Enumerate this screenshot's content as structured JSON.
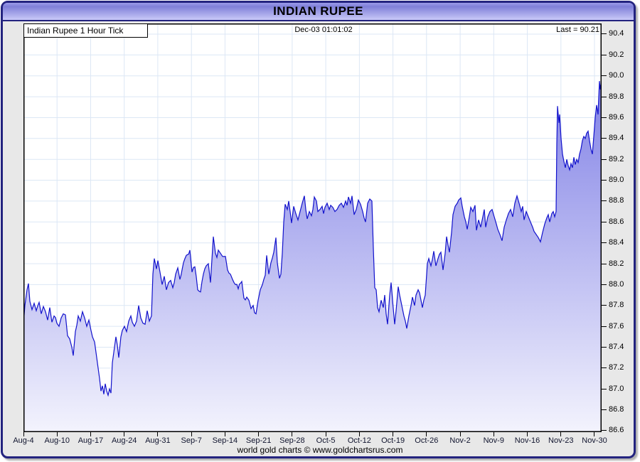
{
  "window": {
    "title": "INDIAN RUPEE"
  },
  "header": {
    "series_label": "Indian Rupee 1 Hour Tick",
    "timestamp": "Dec-03 01:01:02",
    "last_label": "Last = 90.21"
  },
  "footer": {
    "credit": "world gold charts © www.goldchartsrus.com"
  },
  "chart_data": {
    "type": "area",
    "title": "Indian Rupee 1 Hour Tick",
    "timestamp": "Dec-03 01:01:02",
    "last": 90.21,
    "ylabel": "",
    "xlabel": "",
    "ylim": [
      86.6,
      90.4
    ],
    "ytick_step": 0.2,
    "grid": true,
    "legend_position": "none",
    "y_ticks": [
      "90.4",
      "90.2",
      "90.0",
      "89.8",
      "89.6",
      "89.4",
      "89.2",
      "89.0",
      "88.8",
      "88.6",
      "88.4",
      "88.2",
      "88.0",
      "87.8",
      "87.6",
      "87.4",
      "87.2",
      "87.0",
      "86.8",
      "86.6"
    ],
    "x_ticks": [
      "Aug-4",
      "Aug-10",
      "Aug-17",
      "Aug-24",
      "Aug-31",
      "Sep-7",
      "Sep-14",
      "Sep-21",
      "Sep-28",
      "Oct-5",
      "Oct-12",
      "Oct-19",
      "Oct-26",
      "Nov-2",
      "Nov-9",
      "Nov-16",
      "Nov-23",
      "Nov-30"
    ],
    "colors": {
      "line": "#1212cc",
      "fill_top": "#6f6fe2",
      "fill_bottom": "#f3f3fd",
      "grid": "#dce7f5",
      "plot_border": "#000000",
      "titlebar_top": "#7f7fd8",
      "titlebar_bottom": "#c9c9f8",
      "frame": "#23237f",
      "panel_bg": "#e8e8e8"
    },
    "series": [
      {
        "name": "Indian Rupee",
        "points": [
          [
            33,
            87.62
          ],
          [
            35,
            87.8
          ],
          [
            38,
            87.95
          ],
          [
            40,
            88.01
          ],
          [
            42,
            87.84
          ],
          [
            45,
            87.76
          ],
          [
            48,
            87.82
          ],
          [
            51,
            87.75
          ],
          [
            55,
            87.83
          ],
          [
            58,
            87.72
          ],
          [
            61,
            87.79
          ],
          [
            64,
            87.74
          ],
          [
            67,
            87.66
          ],
          [
            70,
            87.78
          ],
          [
            73,
            87.64
          ],
          [
            76,
            87.7
          ],
          [
            80,
            87.63
          ],
          [
            83,
            87.6
          ],
          [
            86,
            87.68
          ],
          [
            89,
            87.72
          ],
          [
            92,
            87.71
          ],
          [
            95,
            87.51
          ],
          [
            98,
            87.48
          ],
          [
            101,
            87.4
          ],
          [
            103,
            87.32
          ],
          [
            106,
            87.55
          ],
          [
            110,
            87.7
          ],
          [
            113,
            87.65
          ],
          [
            116,
            87.74
          ],
          [
            119,
            87.68
          ],
          [
            122,
            87.6
          ],
          [
            125,
            87.66
          ],
          [
            128,
            87.56
          ],
          [
            130,
            87.5
          ],
          [
            133,
            87.45
          ],
          [
            136,
            87.3
          ],
          [
            138,
            87.2
          ],
          [
            140,
            87.1
          ],
          [
            142,
            86.98
          ],
          [
            144,
            87.03
          ],
          [
            146,
            86.95
          ],
          [
            148,
            87.05
          ],
          [
            150,
            86.98
          ],
          [
            152,
            86.94
          ],
          [
            154,
            87.0
          ],
          [
            156,
            86.96
          ],
          [
            158,
            87.25
          ],
          [
            160,
            87.35
          ],
          [
            163,
            87.5
          ],
          [
            165,
            87.42
          ],
          [
            167,
            87.3
          ],
          [
            170,
            87.5
          ],
          [
            172,
            87.56
          ],
          [
            175,
            87.6
          ],
          [
            178,
            87.55
          ],
          [
            181,
            87.65
          ],
          [
            184,
            87.7
          ],
          [
            186,
            87.64
          ],
          [
            189,
            87.6
          ],
          [
            192,
            87.65
          ],
          [
            195,
            87.8
          ],
          [
            198,
            87.68
          ],
          [
            201,
            87.63
          ],
          [
            204,
            87.62
          ],
          [
            207,
            87.75
          ],
          [
            210,
            87.65
          ],
          [
            213,
            87.7
          ],
          [
            215,
            88.1
          ],
          [
            217,
            88.25
          ],
          [
            220,
            88.15
          ],
          [
            222,
            88.23
          ],
          [
            225,
            88.12
          ],
          [
            228,
            88.0
          ],
          [
            231,
            88.08
          ],
          [
            234,
            87.95
          ],
          [
            237,
            88.02
          ],
          [
            240,
            88.04
          ],
          [
            243,
            87.97
          ],
          [
            247,
            88.1
          ],
          [
            250,
            88.16
          ],
          [
            253,
            88.05
          ],
          [
            258,
            88.21
          ],
          [
            262,
            88.28
          ],
          [
            267,
            88.33
          ],
          [
            270,
            88.12
          ],
          [
            274,
            88.17
          ],
          [
            278,
            87.95
          ],
          [
            282,
            87.93
          ],
          [
            286,
            88.1
          ],
          [
            290,
            88.18
          ],
          [
            293,
            88.2
          ],
          [
            296,
            88.02
          ],
          [
            300,
            88.46
          ],
          [
            303,
            88.3
          ],
          [
            305,
            88.26
          ],
          [
            307,
            88.33
          ],
          [
            310,
            88.3
          ],
          [
            313,
            88.27
          ],
          [
            317,
            88.27
          ],
          [
            320,
            88.14
          ],
          [
            324,
            88.1
          ],
          [
            327,
            88.05
          ],
          [
            331,
            88.0
          ],
          [
            335,
            87.96
          ],
          [
            340,
            88.03
          ],
          [
            343,
            87.87
          ],
          [
            347,
            87.88
          ],
          [
            350,
            87.85
          ],
          [
            353,
            87.77
          ],
          [
            356,
            87.8
          ],
          [
            358,
            87.73
          ],
          [
            360,
            87.72
          ],
          [
            363,
            87.85
          ],
          [
            366,
            87.95
          ],
          [
            369,
            88.0
          ],
          [
            371,
            88.05
          ],
          [
            373,
            88.09
          ],
          [
            375,
            88.28
          ],
          [
            378,
            88.1
          ],
          [
            381,
            88.21
          ],
          [
            385,
            88.31
          ],
          [
            388,
            88.45
          ],
          [
            390,
            88.21
          ],
          [
            393,
            88.06
          ],
          [
            395,
            88.1
          ],
          [
            397,
            88.3
          ],
          [
            399,
            88.6
          ],
          [
            401,
            88.77
          ],
          [
            404,
            88.72
          ],
          [
            406,
            88.8
          ],
          [
            408,
            88.7
          ],
          [
            410,
            88.59
          ],
          [
            413,
            88.75
          ],
          [
            416,
            88.68
          ],
          [
            419,
            88.62
          ],
          [
            422,
            88.7
          ],
          [
            425,
            88.78
          ],
          [
            428,
            88.85
          ],
          [
            430,
            88.72
          ],
          [
            432,
            88.63
          ],
          [
            435,
            88.7
          ],
          [
            438,
            88.66
          ],
          [
            440,
            88.72
          ],
          [
            442,
            88.84
          ],
          [
            445,
            88.8
          ],
          [
            447,
            88.7
          ],
          [
            450,
            88.72
          ],
          [
            453,
            88.75
          ],
          [
            455,
            88.68
          ],
          [
            457,
            88.74
          ],
          [
            460,
            88.78
          ],
          [
            463,
            88.72
          ],
          [
            465,
            88.76
          ],
          [
            468,
            88.74
          ],
          [
            471,
            88.7
          ],
          [
            474,
            88.72
          ],
          [
            477,
            88.76
          ],
          [
            480,
            88.78
          ],
          [
            483,
            88.74
          ],
          [
            486,
            88.8
          ],
          [
            488,
            88.76
          ],
          [
            490,
            88.84
          ],
          [
            493,
            88.78
          ],
          [
            495,
            88.85
          ],
          [
            498,
            88.67
          ],
          [
            501,
            88.72
          ],
          [
            504,
            88.81
          ],
          [
            507,
            88.77
          ],
          [
            510,
            88.7
          ],
          [
            512,
            88.64
          ],
          [
            514,
            88.6
          ],
          [
            517,
            88.78
          ],
          [
            520,
            88.82
          ],
          [
            523,
            88.8
          ],
          [
            525,
            88.35
          ],
          [
            527,
            87.97
          ],
          [
            529,
            87.95
          ],
          [
            531,
            87.78
          ],
          [
            533,
            87.74
          ],
          [
            536,
            87.85
          ],
          [
            539,
            87.78
          ],
          [
            541,
            87.9
          ],
          [
            543,
            87.72
          ],
          [
            545,
            87.62
          ],
          [
            548,
            87.9
          ],
          [
            550,
            88.02
          ],
          [
            552,
            87.85
          ],
          [
            555,
            87.62
          ],
          [
            557,
            87.75
          ],
          [
            560,
            87.98
          ],
          [
            562,
            87.9
          ],
          [
            565,
            87.8
          ],
          [
            568,
            87.7
          ],
          [
            570,
            87.65
          ],
          [
            572,
            87.58
          ],
          [
            575,
            87.7
          ],
          [
            578,
            87.8
          ],
          [
            580,
            87.88
          ],
          [
            583,
            87.8
          ],
          [
            585,
            87.9
          ],
          [
            588,
            87.95
          ],
          [
            590,
            87.92
          ],
          [
            592,
            87.85
          ],
          [
            594,
            87.78
          ],
          [
            596,
            87.85
          ],
          [
            598,
            87.9
          ],
          [
            601,
            88.2
          ],
          [
            603,
            88.25
          ],
          [
            606,
            88.18
          ],
          [
            610,
            88.32
          ],
          [
            613,
            88.18
          ],
          [
            616,
            88.25
          ],
          [
            620,
            88.31
          ],
          [
            623,
            88.14
          ],
          [
            626,
            88.3
          ],
          [
            628,
            88.46
          ],
          [
            632,
            88.31
          ],
          [
            635,
            88.5
          ],
          [
            637,
            88.67
          ],
          [
            640,
            88.75
          ],
          [
            643,
            88.78
          ],
          [
            645,
            88.81
          ],
          [
            648,
            88.83
          ],
          [
            650,
            88.75
          ],
          [
            653,
            88.65
          ],
          [
            657,
            88.53
          ],
          [
            660,
            88.65
          ],
          [
            662,
            88.74
          ],
          [
            665,
            88.7
          ],
          [
            668,
            88.76
          ],
          [
            670,
            88.52
          ],
          [
            673,
            88.62
          ],
          [
            676,
            88.55
          ],
          [
            679,
            88.65
          ],
          [
            681,
            88.72
          ],
          [
            683,
            88.55
          ],
          [
            686,
            88.65
          ],
          [
            689,
            88.7
          ],
          [
            692,
            88.72
          ],
          [
            695,
            88.65
          ],
          [
            698,
            88.58
          ],
          [
            700,
            88.53
          ],
          [
            703,
            88.48
          ],
          [
            706,
            88.42
          ],
          [
            709,
            88.55
          ],
          [
            712,
            88.62
          ],
          [
            715,
            88.68
          ],
          [
            718,
            88.72
          ],
          [
            721,
            88.65
          ],
          [
            724,
            88.78
          ],
          [
            727,
            88.85
          ],
          [
            730,
            88.78
          ],
          [
            733,
            88.7
          ],
          [
            735,
            88.75
          ],
          [
            737,
            88.62
          ],
          [
            740,
            88.7
          ],
          [
            743,
            88.65
          ],
          [
            746,
            88.6
          ],
          [
            749,
            88.55
          ],
          [
            751,
            88.51
          ],
          [
            754,
            88.48
          ],
          [
            757,
            88.45
          ],
          [
            760,
            88.41
          ],
          [
            763,
            88.5
          ],
          [
            766,
            88.58
          ],
          [
            769,
            88.64
          ],
          [
            771,
            88.67
          ],
          [
            773,
            88.6
          ],
          [
            776,
            88.68
          ],
          [
            778,
            88.7
          ],
          [
            780,
            88.65
          ],
          [
            782,
            88.7
          ],
          [
            783,
            89.35
          ],
          [
            784,
            89.71
          ],
          [
            786,
            89.55
          ],
          [
            787,
            89.63
          ],
          [
            789,
            89.4
          ],
          [
            791,
            89.25
          ],
          [
            793,
            89.18
          ],
          [
            795,
            89.12
          ],
          [
            797,
            89.2
          ],
          [
            799,
            89.14
          ],
          [
            801,
            89.1
          ],
          [
            803,
            89.16
          ],
          [
            805,
            89.12
          ],
          [
            807,
            89.22
          ],
          [
            809,
            89.15
          ],
          [
            811,
            89.2
          ],
          [
            813,
            89.17
          ],
          [
            815,
            89.25
          ],
          [
            817,
            89.3
          ],
          [
            819,
            89.38
          ],
          [
            821,
            89.42
          ],
          [
            823,
            89.4
          ],
          [
            825,
            89.45
          ],
          [
            827,
            89.47
          ],
          [
            829,
            89.38
          ],
          [
            831,
            89.3
          ],
          [
            833,
            89.25
          ],
          [
            835,
            89.42
          ],
          [
            837,
            89.6
          ],
          [
            839,
            89.72
          ],
          [
            841,
            89.63
          ],
          [
            842,
            89.8
          ],
          [
            843,
            89.95
          ],
          [
            844,
            89.87
          ],
          [
            845,
            89.92
          ],
          [
            846,
            90.05
          ],
          [
            846.5,
            90.21
          ]
        ]
      }
    ]
  }
}
